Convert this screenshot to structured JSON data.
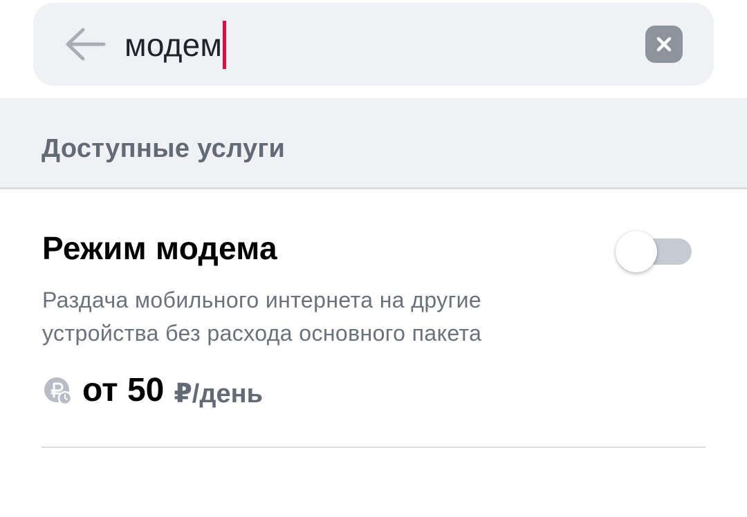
{
  "search": {
    "value": "модем",
    "back_icon": "arrow-left-icon",
    "clear_icon": "close-icon",
    "caret_color": "#e30b3f"
  },
  "section": {
    "title": "Доступные услуги"
  },
  "service": {
    "title": "Режим модема",
    "description_line1": "Раздача мобильного интернета на другие",
    "description_line2": "устройства без расхода основного пакета",
    "toggle_on": false,
    "price_icon": "ruble-coin-icon",
    "price_amount": "от 50",
    "price_unit": "₽/день"
  },
  "colors": {
    "background": "#ffffff",
    "surface": "#f0f1f5",
    "muted_text": "#626a75",
    "accent": "#e30b3f",
    "toggle_track": "#c6cad2"
  }
}
